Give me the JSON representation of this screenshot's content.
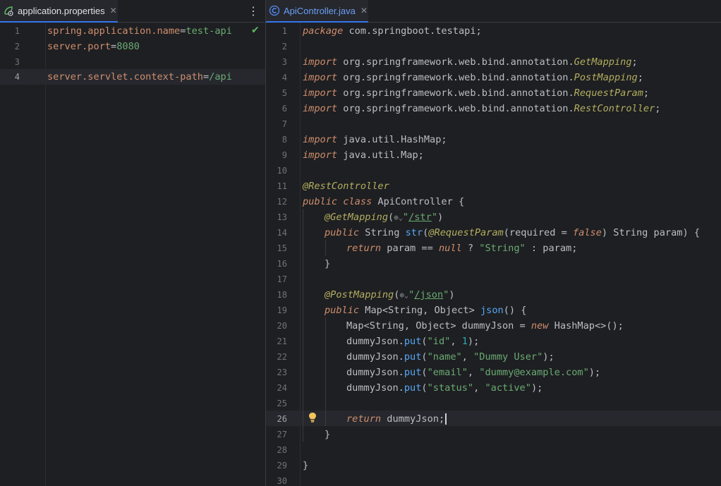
{
  "left_tab": {
    "label": "application.properties",
    "close": "✕",
    "icon": "spring-properties-icon",
    "menu": "⋮"
  },
  "right_tab": {
    "label": "ApiController.java",
    "close": "✕",
    "icon": "java-class-icon"
  },
  "colors": {
    "accent": "#3574f0",
    "keyword": "#cf8e6d",
    "string": "#6aab73",
    "annotation": "#b3ae60",
    "function": "#56a8f5",
    "number": "#2aacb8"
  },
  "properties_file": {
    "line_numbers": [
      "1",
      "2",
      "3",
      "4"
    ],
    "current_line": "4",
    "lines": [
      {
        "key": "spring.application.name",
        "eq": "=",
        "value": "test-api"
      },
      {
        "key": "server.port",
        "eq": "=",
        "value": "8080"
      },
      {
        "key": "",
        "eq": "",
        "value": ""
      },
      {
        "key": "server.servlet.context-path",
        "eq": "=",
        "value": "/api"
      }
    ],
    "status_icon": "checkmark-icon"
  },
  "java_file": {
    "line_numbers": [
      "1",
      "2",
      "3",
      "4",
      "5",
      "6",
      "7",
      "8",
      "9",
      "10",
      "11",
      "12",
      "13",
      "14",
      "15",
      "16",
      "17",
      "18",
      "19",
      "20",
      "21",
      "22",
      "23",
      "24",
      "25",
      "26",
      "27",
      "28",
      "29",
      "30"
    ],
    "current_line": "26",
    "t": {
      "package": "package",
      "pkg_name": " com.springboot.testapi;",
      "import": "import",
      "imp_prefix": " org.springframework.web.bind.annotation.",
      "GetMapping": "GetMapping",
      "PostMapping": "PostMapping",
      "RequestParam": "RequestParam",
      "RestController": "RestController",
      "semi": ";",
      "imp_hashmap": " java.util.HashMap;",
      "imp_map": " java.util.Map;",
      "at_restcontroller": "@RestController",
      "public": "public",
      "class": "class",
      "class_decl": " ApiController {",
      "at_getmapping": "@GetMapping",
      "open_paren": "(",
      "globe": "⊕",
      "chev": "⌄",
      "quote": "\"",
      "str_path": "/str",
      "close_paren": ")",
      "string_type": " String ",
      "str_fn": "str",
      "at_requestparam": "@RequestParam",
      "required_eq": "(required = ",
      "false": "false",
      "param_decl": ") String param) {",
      "return": "return",
      "ret_expr1": " param == ",
      "null": "null",
      "ret_expr2": " ? ",
      "string_lit": "\"String\"",
      "ret_expr3": " : param;",
      "close_brace": "}",
      "at_postmapping": "@PostMapping",
      "json_path": "/json",
      "map_type": " Map<String, Object> ",
      "json_fn": "json",
      "fn_tail": "() {",
      "map_decl": "Map<String, Object> dummyJson = ",
      "new": "new",
      "hashmap_tail": " HashMap<>();",
      "dj": "dummyJson.",
      "put": "put",
      "put1_a": "(",
      "k_id": "\"id\"",
      "comma": ", ",
      "v_1": "1",
      "put_end": ");",
      "k_name": "\"name\"",
      "v_name": "\"Dummy User\"",
      "k_email": "\"email\"",
      "v_email": "\"dummy@example.com\"",
      "k_status": "\"status\"",
      "v_status": "\"active\"",
      "ret_dummy": " dummyJson;"
    },
    "intention_icon": "lightbulb-icon"
  }
}
